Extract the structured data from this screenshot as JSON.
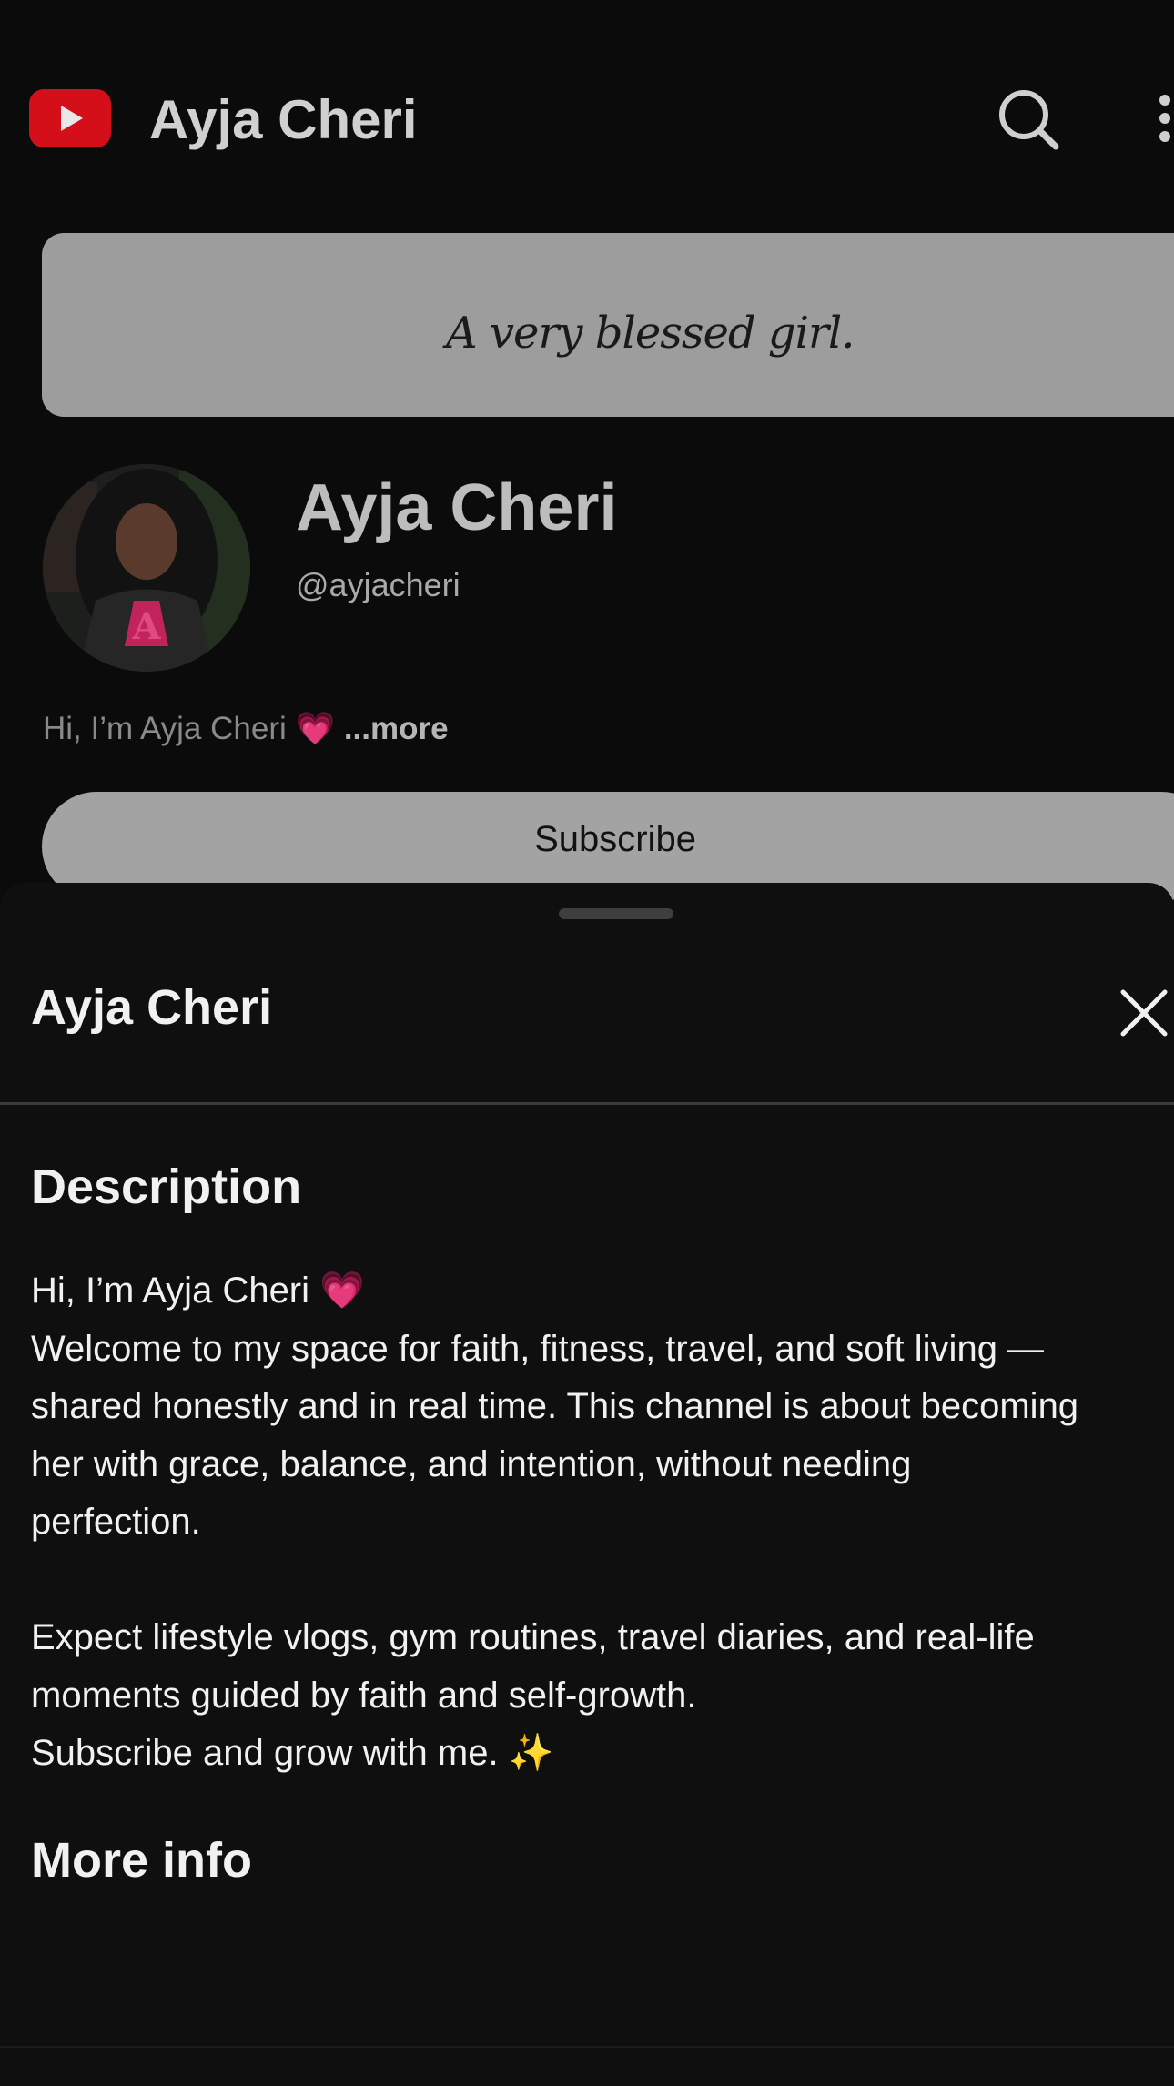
{
  "app": {
    "title": "Ayja Cheri",
    "logo_icon": "youtube-logo-icon",
    "search_icon": "search-icon",
    "more_icon": "more-vertical-icon"
  },
  "channel": {
    "banner_text": "A very blessed girl.",
    "name": "Ayja Cheri",
    "handle": "@ayjacheri",
    "short_description": "Hi, I’m Ayja Cheri 💗",
    "more_link": "...more",
    "subscribe_label": "Subscribe"
  },
  "sheet": {
    "title": "Ayja Cheri",
    "close_icon": "close-icon",
    "description_heading": "Description",
    "description_lines": [
      "Hi, I’m Ayja Cheri 💗",
      "Welcome to my space for faith, fitness, travel, and soft living —",
      "shared honestly and in real time. This channel is about becoming",
      "her with grace, balance, and intention, without needing",
      "perfection.",
      "Expect lifestyle vlogs, gym routines, travel diaries, and real-life",
      "moments guided by faith and self-growth.",
      "Subscribe and grow with me. ✨"
    ],
    "more_info_heading": "More info"
  },
  "colors": {
    "background": "#0b0b0c",
    "sheet_background": "#0f0f10",
    "youtube_red": "#d40f1a",
    "banner_gray": "#9d9d9d",
    "subscribe_gray": "#a3a3a3",
    "text_primary": "#f1f1f1"
  }
}
